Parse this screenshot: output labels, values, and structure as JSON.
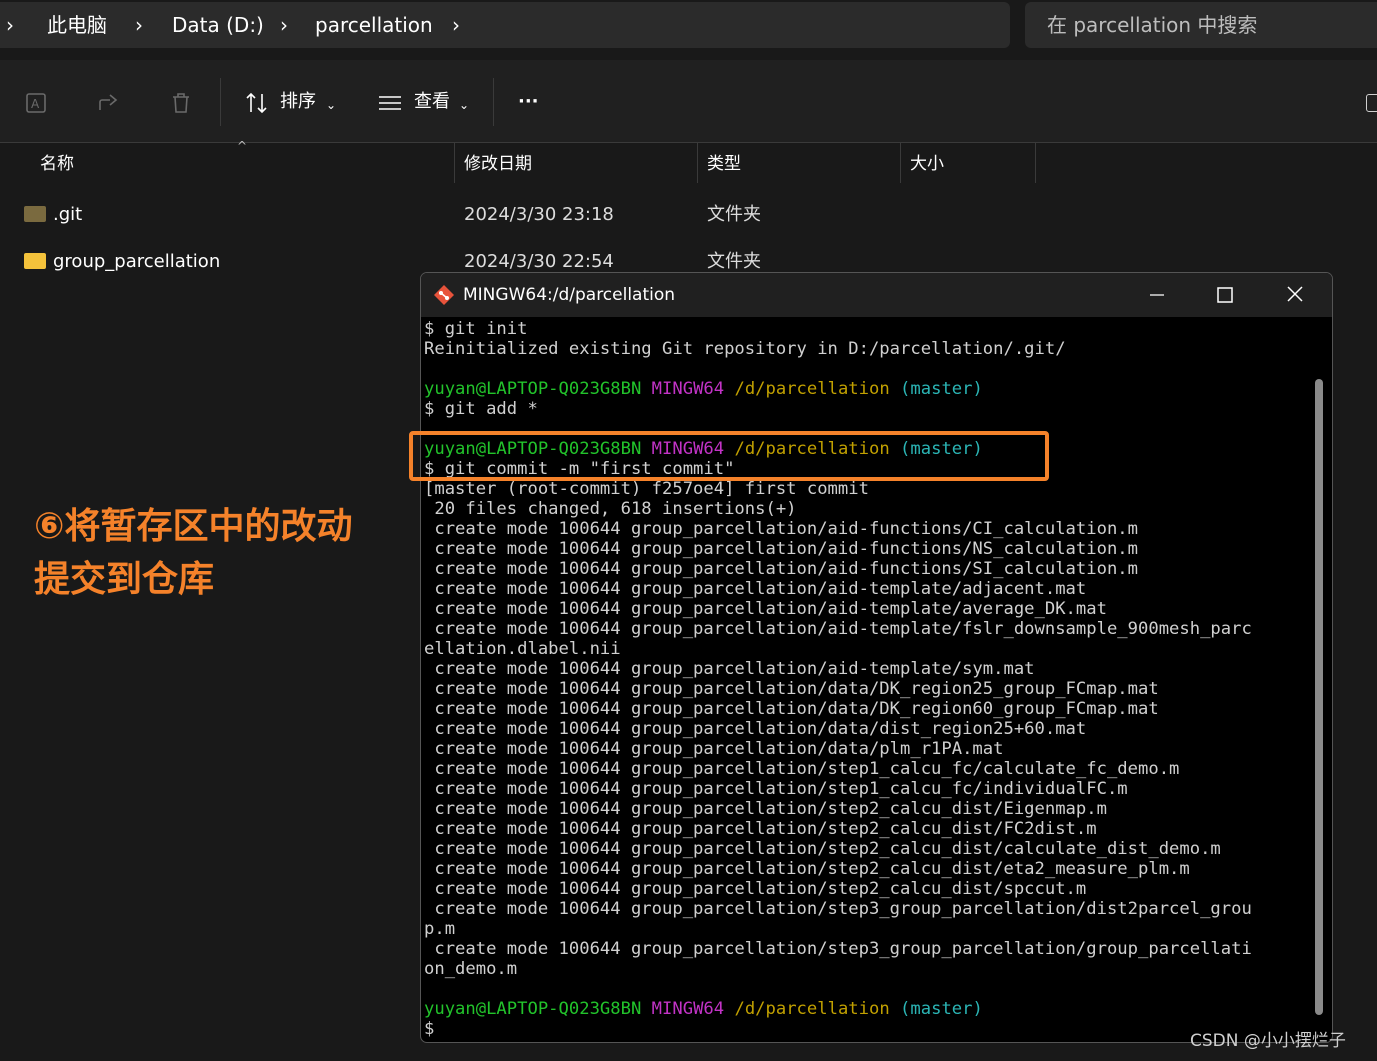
{
  "address": {
    "crumbs": [
      "此电脑",
      "Data (D:)",
      "parcellation"
    ],
    "search_placeholder": "在 parcellation 中搜索"
  },
  "commandbar": {
    "sort_label": "排序",
    "view_label": "查看",
    "more_label": "···"
  },
  "columns": {
    "name": "名称",
    "modified": "修改日期",
    "type": "类型",
    "size": "大小"
  },
  "files": [
    {
      "name": ".git",
      "modified": "2024/3/30 23:18",
      "type": "文件夹"
    },
    {
      "name": "group_parcellation",
      "modified": "2024/3/30 22:54",
      "type": "文件夹"
    }
  ],
  "annotation": {
    "line1": "⑥将暂存区中的改动",
    "line2": "提交到仓库"
  },
  "terminal": {
    "title": "MINGW64:/d/parcellation",
    "prompt": {
      "user": "yuyan@LAPTOP-Q023G8BN",
      "env": "MINGW64",
      "path": "/d/parcellation",
      "branch": "(master)"
    },
    "lines": [
      "$ git init",
      "Reinitialized existing Git repository in D:/parcellation/.git/",
      "",
      "",
      "$ git add *",
      "",
      "",
      "$ git commit -m \"first commit\"",
      "[master (root-commit) f257oe4] first commit",
      " 20 files changed, 618 insertions(+)",
      " create mode 100644 group_parcellation/aid-functions/CI_calculation.m",
      " create mode 100644 group_parcellation/aid-functions/NS_calculation.m",
      " create mode 100644 group_parcellation/aid-functions/SI_calculation.m",
      " create mode 100644 group_parcellation/aid-template/adjacent.mat",
      " create mode 100644 group_parcellation/aid-template/average_DK.mat",
      " create mode 100644 group_parcellation/aid-template/fslr_downsample_900mesh_parc",
      "ellation.dlabel.nii",
      " create mode 100644 group_parcellation/aid-template/sym.mat",
      " create mode 100644 group_parcellation/data/DK_region25_group_FCmap.mat",
      " create mode 100644 group_parcellation/data/DK_region60_group_FCmap.mat",
      " create mode 100644 group_parcellation/data/dist_region25+60.mat",
      " create mode 100644 group_parcellation/data/plm_r1PA.mat",
      " create mode 100644 group_parcellation/step1_calcu_fc/calculate_fc_demo.m",
      " create mode 100644 group_parcellation/step1_calcu_fc/individualFC.m",
      " create mode 100644 group_parcellation/step2_calcu_dist/Eigenmap.m",
      " create mode 100644 group_parcellation/step2_calcu_dist/FC2dist.m",
      " create mode 100644 group_parcellation/step2_calcu_dist/calculate_dist_demo.m",
      " create mode 100644 group_parcellation/step2_calcu_dist/eta2_measure_plm.m",
      " create mode 100644 group_parcellation/step2_calcu_dist/spccut.m",
      " create mode 100644 group_parcellation/step3_group_parcellation/dist2parcel_grou",
      "p.m",
      " create mode 100644 group_parcellation/step3_group_parcellation/group_parcellati",
      "on_demo.m",
      "",
      "",
      "$"
    ]
  },
  "watermark": "CSDN @小小摆烂子",
  "colors": {
    "accent": "#f5822a",
    "prompt_user": "#22c32b",
    "prompt_env": "#c233c6",
    "prompt_path": "#c1a000",
    "prompt_branch": "#2bb5b5"
  }
}
